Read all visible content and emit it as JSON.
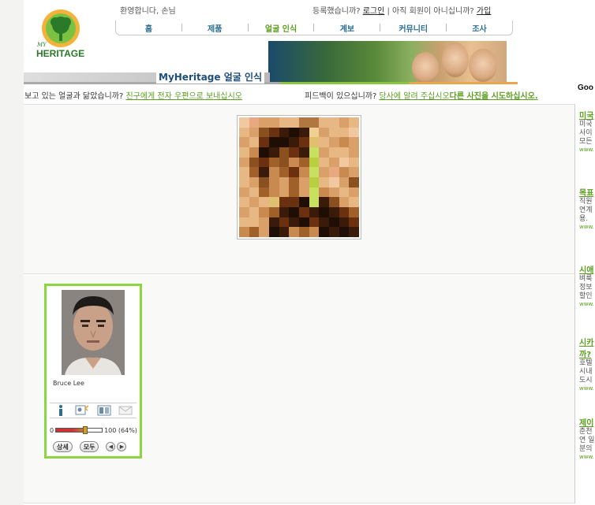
{
  "header": {
    "logo_small": "MY",
    "logo_text": "HERITAGE",
    "greeting": "환영합니다, 손님",
    "login_prompt": "등록했습니까?",
    "login_link": "로그인",
    "signup_prompt": " | 아직 회원이 아니십니까?",
    "signup_link": "가입"
  },
  "nav": {
    "items": [
      {
        "label": "홈"
      },
      {
        "label": "제품"
      },
      {
        "label": "얼굴 인식"
      },
      {
        "label": "계보"
      },
      {
        "label": "커뮤니티"
      },
      {
        "label": "조사"
      }
    ]
  },
  "page_title": "MyHeritage 얼굴 인식",
  "subline": {
    "left_text": "보고 있는 얼굴과 닮았습니까?",
    "left_link": "친구에게 전자 우편으로 보내십시오",
    "right_text": "피드백이 있으십니까?",
    "right_link": "당사에 알려 주십시오",
    "right_bold_link": "다른 사진을 시도하십시오."
  },
  "match_card": {
    "name": "Bruce Lee",
    "score_min": "0",
    "score_text": "100 (64%)",
    "score_fraction": 0.64,
    "btn_detail": "상세",
    "btn_all": "모두",
    "icons": [
      "info-icon",
      "search-person-icon",
      "compare-icon",
      "email-icon"
    ]
  },
  "ads": {
    "heading": "Goo",
    "items": [
      {
        "title": "미국",
        "lines": [
          "미국",
          "사이",
          "모든"
        ],
        "url": "www."
      },
      {
        "title": "목표",
        "lines": [
          "직원",
          "연계",
          "용."
        ],
        "url": "www."
      },
      {
        "title": "시애",
        "lines": [
          "벼룩",
          "정보",
          "할인"
        ],
        "url": "www."
      },
      {
        "title": "시카",
        "title2": "까?",
        "lines": [
          "호텔",
          "시내",
          "도시"
        ],
        "url": "www."
      },
      {
        "title": "제이",
        "lines": [
          "춘천",
          "연 일",
          "분의"
        ],
        "url": "www."
      }
    ]
  },
  "colors": {
    "accent_green": "#8cd63f",
    "link_green": "#5a9e1c",
    "nav_blue": "#2a6e8f",
    "title_blue": "#1d4f7a"
  }
}
